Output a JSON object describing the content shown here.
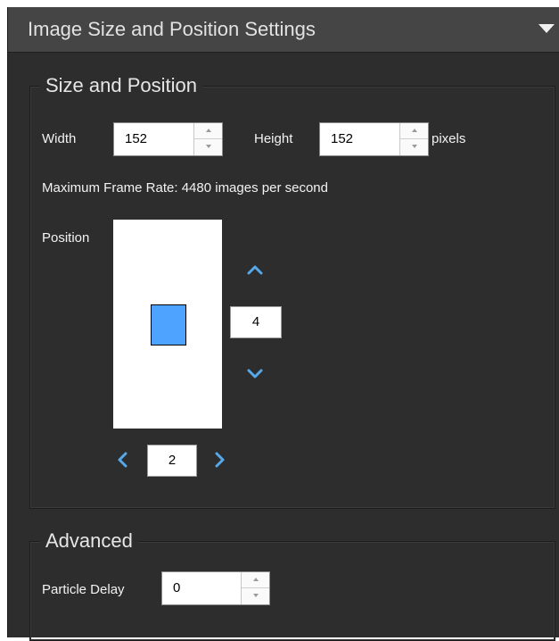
{
  "panel": {
    "title": "Image Size and Position Settings",
    "collapse_icon": "caret-down-icon"
  },
  "size_position": {
    "legend": "Size and Position",
    "width_label": "Width",
    "width_value": "152",
    "height_label": "Height",
    "height_value": "152",
    "units_label": "pixels",
    "frame_rate_text": "Maximum Frame Rate: 4480 images per second",
    "position_label": "Position",
    "vertical_value": "4",
    "horizontal_value": "2",
    "icons": {
      "up": "chevron-up-icon",
      "down": "chevron-down-icon",
      "left": "chevron-left-icon",
      "right": "chevron-right-icon"
    }
  },
  "advanced": {
    "legend": "Advanced",
    "particle_delay_label": "Particle Delay",
    "particle_delay_value": "0"
  },
  "colors": {
    "panel_bg": "#2d2d2d",
    "header_bg": "#454545",
    "accent": "#4da3ff",
    "arrow": "#56a8e8"
  }
}
